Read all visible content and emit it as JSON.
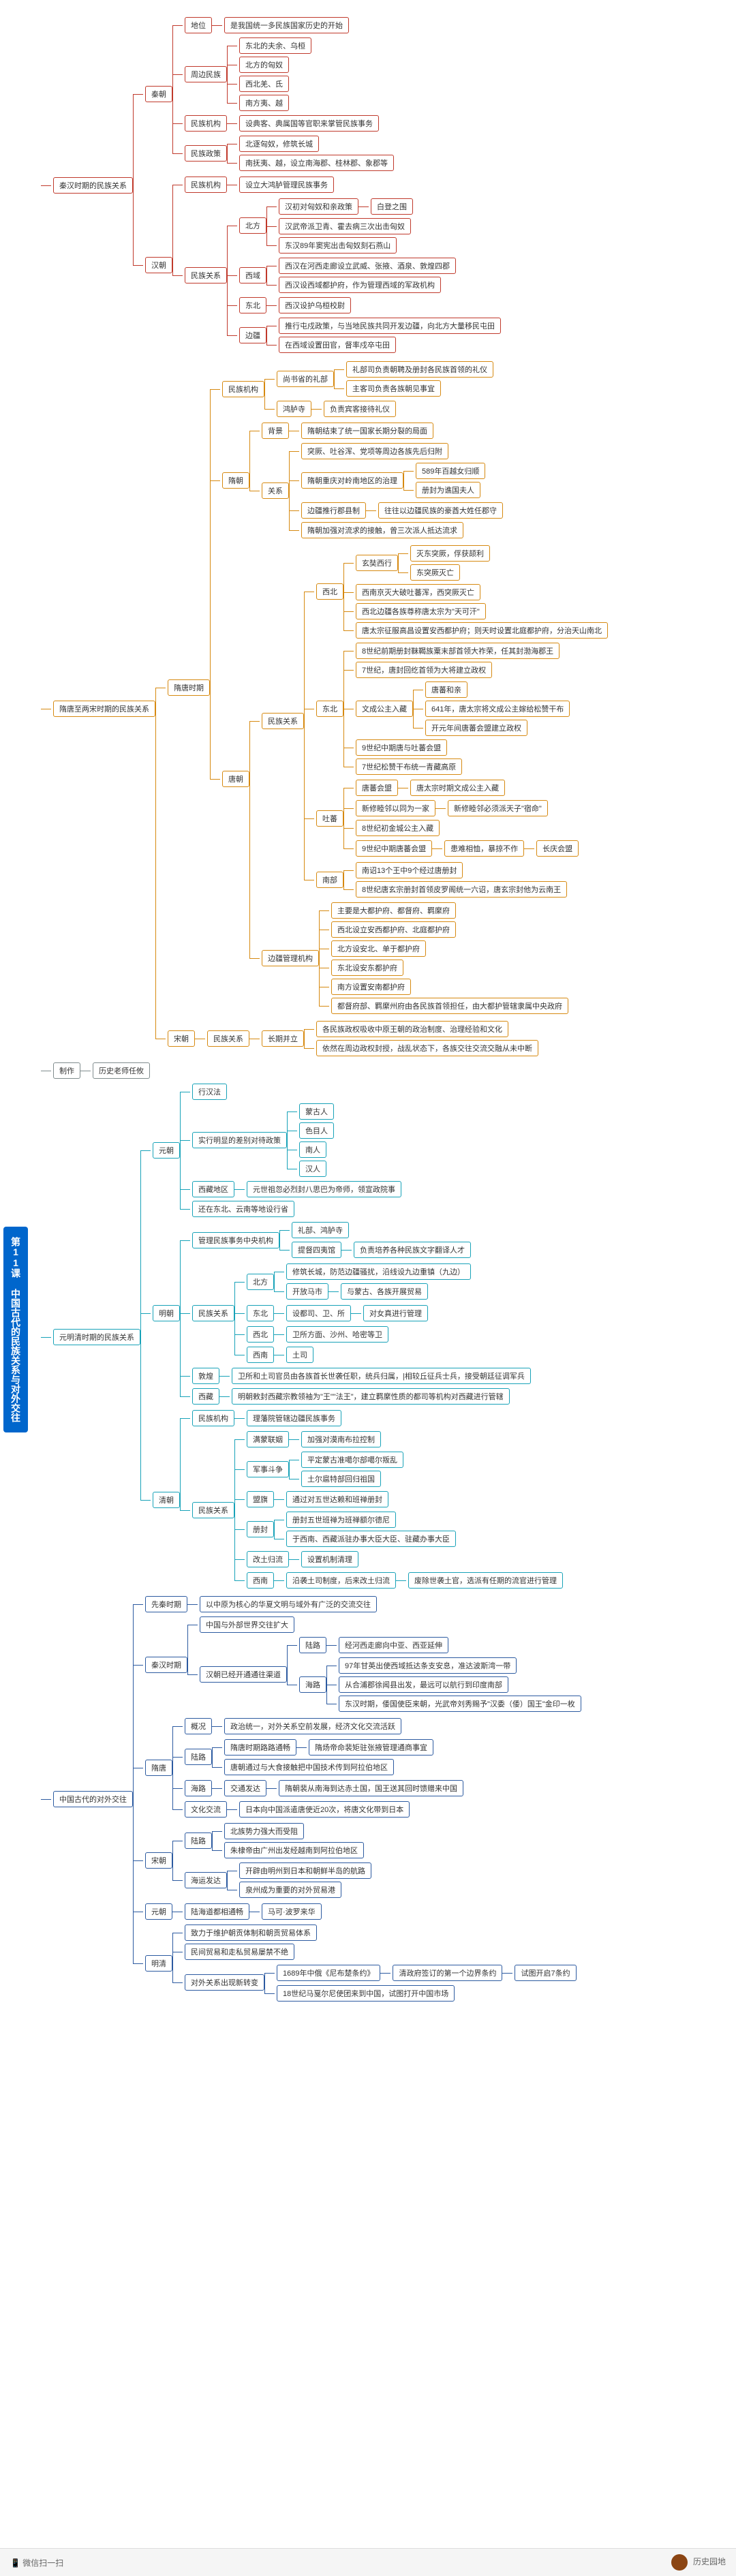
{
  "root": "第11课 中国古代的民族关系与对外交往",
  "s1": {
    "title": "秦汉时期的民族关系",
    "qin": {
      "label": "秦朝",
      "diwei": "地位",
      "diwei_v": "是我国统一多民族国家历史的开始",
      "zhoubian": "周边民族",
      "zb1": "东北的夫余、乌桓",
      "zb2": "北方的匈奴",
      "zb3": "西北羌、氐",
      "zb4": "南方夷、越",
      "jigou": "民族机构",
      "jigou_v": "设典客、典属国等官职来掌管民族事务",
      "zhengce": "民族政策",
      "zc1": "北逐匈奴，修筑长城",
      "zc2": "南抚夷、越，设立南海郡、桂林郡、象郡等"
    },
    "han": {
      "label": "汉朝",
      "jigou": "民族机构",
      "jigou_v": "设立大鸿胪管理民族事务",
      "gx": "民族关系",
      "bei": "北方",
      "b1": "汉初对匈奴和亲政策",
      "b1r": "白登之围",
      "b2": "汉武帝派卫青、霍去病三次出击匈奴",
      "b3": "东汉89年窦宪出击匈奴刻石燕山",
      "xi": "西域",
      "x1": "西汉在河西走廊设立武威、张掖、酒泉、敦煌四郡",
      "x2": "西汉设西域都护府，作为管理西域的军政机构",
      "db": "东北",
      "db1": "西汉设护乌桓校尉",
      "bj": "边疆",
      "bj1": "推行屯戍政策，与当地民族共同开发边疆，向北方大量移民屯田",
      "bj2": "在西域设置田官，督率戍卒屯田"
    }
  },
  "s2": {
    "title": "隋唐至两宋时期的民族关系",
    "sui_tang": "隋唐时期",
    "jigou": "民族机构",
    "sbsheng": "尚书省的礼部",
    "lb1": "礼部司负责朝聘及册封各民族首领的礼仪",
    "lb2": "主客司负责各族朝见事宜",
    "hlsi": "鸿胪寺",
    "hlsi_v": "负责宾客接待礼仪",
    "sui": "隋朝",
    "bj": "背景",
    "bj_v": "隋朝结束了统一国家长期分裂的局面",
    "gx": "关系",
    "gx1": "突厥、吐谷浑、党项等周边各族先后归附",
    "gx2": "隋朝重庆对岭南地区的治理",
    "gx2a": "589年百越女归顺",
    "gx2b": "册封为谯国夫人",
    "gx3": "边疆推行郡县制",
    "gx3v": "往往以边疆民族的豪酋大姓任郡守",
    "gx4": "隋朝加强对流求的接触，曾三次派人抵达流求",
    "tang": "唐朝",
    "mzgx": "民族关系",
    "xb": "西北",
    "xb1": "玄奘西行",
    "xb1a": "灭东突厥，俘获颉利",
    "xb1b": "东突厥灭亡",
    "xb2": "西南京灭大破吐蕃浑，西突厥灭亡",
    "xb3": "西北边疆各族尊称唐太宗为\"天可汗\"",
    "xb4": "唐太宗征服高昌设置安西都护府；则天时设置北庭都护府，分治天山南北",
    "db": "东北",
    "db1": "8世纪前期册封靺鞨族粟末部首领大祚荣，任其封渤海郡王",
    "db2": "7世纪，唐封回纥首领为大将建立政权",
    "db3": "文成公主入藏",
    "db3a": "唐蕃和亲",
    "db3b": "641年，唐太宗将文成公主嫁给松赞干布",
    "db3c": "开元年间唐蕃会盟建立政权",
    "db4": "9世纪中期唐与吐蕃会盟",
    "db5": "7世纪松赞干布统一青藏高原",
    "tf": "吐蕃",
    "tf1": "唐蕃会盟",
    "tf1a": "唐太宗时期文成公主入藏",
    "tf2": "新修睦邻以同为一家",
    "tf2b": "新修睦邻必须派天子\"宿命\"",
    "tf3": "8世纪初金城公主入藏",
    "tf4": "9世纪中期唐蕃会盟",
    "tf4a": "患难相恤，暴掠不作",
    "tf4b": "长庆会盟",
    "nb": "南部",
    "nb1": "南诏13个王中9个经过唐册封",
    "nb2": "8世纪唐玄宗册封首领皮罗阁统一六诏，唐玄宗封他为云南王",
    "bjjg": "边疆管理机构",
    "bj1": "主要是大都护府、都督府、羁縻府",
    "bj2": "西北设立安西都护府、北庭都护府",
    "bj3": "北方设安北、单于都护府",
    "bj4": "东北设安东都护府",
    "bj5": "南方设置安南都护府",
    "bj6": "都督府部、羁縻州府由各民族首领担任，由大都护管辖隶属中央政府",
    "song": "宋朝",
    "smzgx": "民族关系",
    "cq": "长期并立",
    "cq1": "各民族政权吸收中原王朝的政治制度、治理经验和文化",
    "cq2": "依然在周边政权封授，战乱状态下，各族交往交流交融从未中断"
  },
  "s3": {
    "title": "制作",
    "v": "历史老师任攸"
  },
  "s4": {
    "title": "元明清时期的民族关系",
    "yuan": "元朝",
    "xhf": "行汉法",
    "sdc": "实行明显的差别对待政策",
    "sd1": "蒙古人",
    "sd2": "色目人",
    "sd3": "南人",
    "sd4": "汉人",
    "xz": "西藏地区",
    "xz_v": "元世祖忽必烈封八思巴为帝师，领宣政院事",
    "db": "还在东北、云南等地设行省",
    "ming": "明朝",
    "jgm": "管理民族事务中央机构",
    "jg1": "礼部、鸿胪寺",
    "jg2": "提督四夷馆",
    "jg2v": "负责培养各种民族文字翻译人才",
    "mzgx": "民族关系",
    "mbei": "北方",
    "mb1": "修筑长城，防范边疆骚扰，沿线设九边重镇（九边）",
    "mb2": "开放马市",
    "mb2v": "与蒙古、各族开展贸易",
    "mdb": "东北",
    "mdb1": "设都司、卫、所",
    "mdb1v": "对女真进行管理",
    "mxb": "西北",
    "mxb1": "卫所方面、沙州、哈密等卫",
    "mxn": "西南",
    "mxn1": "土司",
    "dunliang": "敦煌",
    "dl_v": "卫所和土司官员由各族首长世袭任职，统兵归属，|相较丘征兵士兵，接受朝廷征调军兵",
    "mxz": "西藏",
    "mxz_v": "明朝敕封西藏宗教领袖为\"王\"\"法王\"，建立羁縻性质的都司等机构对西藏进行管辖",
    "qing": "清朝",
    "qjg": "民族机构",
    "qjg_v": "理藩院管辖边疆民族事务",
    "qds": "满蒙联姻",
    "qds_v": "加强对漠南布拉控制",
    "jd": "军事斗争",
    "jd1": "平定蒙古准噶尔部噶尔叛乱",
    "jd2": "土尔扈特部回归祖国",
    "mzgxq": "民族关系",
    "hm": "盟旗",
    "hm_v": "通过对五世达赖和班禅册封",
    "cf": "册封",
    "cf1": "册封五世班禅为班禅额尔德尼",
    "cf2": "于西南、西藏派驻办事大臣大臣、驻藏办事大臣",
    "gtl": "改土归流",
    "gtl_v": "设置机制清理",
    "xnq": "西南",
    "xnq_v": "沿袭土司制度，后来改土归流",
    "xnq2": "废除世袭土官，选派有任期的流官进行管理"
  },
  "s5": {
    "title": "中国古代的对外交往",
    "xq": "先秦时期",
    "xq_v": "以中原为核心的华夏文明与域外有广泛的交流交往",
    "qh": "秦汉时期",
    "qh1": "中国与外部世界交往扩大",
    "hl": "陆路",
    "hl_v": "经河西走廊向中亚、西亚延伸",
    "hai": "海路",
    "hai1": "97年甘英出使西域抵达条支安息，准达波斯湾一带",
    "hai2": "从合浦郡徐闻县出发，最远可以航行到印度南部",
    "hai3": "东汉时期，倭国使臣来朝，光武帝刘秀赐予\"汉委（倭）国王\"金印一枚",
    "hjt": "汉朝已经开通通往渠道",
    "st": "隋唐",
    "gk": "概况",
    "gk_v": "政治统一，对外关系空前发展，经济文化交流活跃",
    "lulu": "陆路",
    "ll1": "隋唐时期路路通畅",
    "ll1v": "隋炀帝命裴矩驻张掖管理通商事宜",
    "ll2": "唐朝通过与大食接触把中国技术传到阿拉伯地区",
    "hail": "海路",
    "hail_v": "交通发达",
    "hail2": "隋朝裴从南海到达赤土国，国王送其回时馈赠来中国",
    "wh": "文化交流",
    "wh_v": "日本向中国派遣唐使近20次，将唐文化带到日本",
    "songc": "宋朝",
    "scl": "陆路",
    "scl_v": "北族势力强大而受阻",
    "scl2": "朱棣帝由广州出发经越南到阿拉伯地区",
    "hys": "海运发达",
    "hys1": "开辟由明州到日本和朝鲜半岛的航路",
    "hys2": "泉州成为重要的对外贸易港",
    "yd": "元朝",
    "yd1": "陆海道都相通畅",
    "yd2": "马可·波罗来华",
    "mq": "明清",
    "mq1": "致力于维护朝贡体制和朝贡贸易体系",
    "mq2": "民间贸易和走私贸易屡禁不绝",
    "dw": "对外关系出现新转变",
    "dw1": "1689年中俄《尼布楚条约》",
    "dw1v": "清政府签订的第一个边界条约",
    "dw1r": "试图开启7条约",
    "dw2": "18世纪马戛尔尼使团来到中国，试图打开中国市场"
  },
  "footer": {
    "author": "历史园地",
    "platform": "微信扫一扫"
  }
}
